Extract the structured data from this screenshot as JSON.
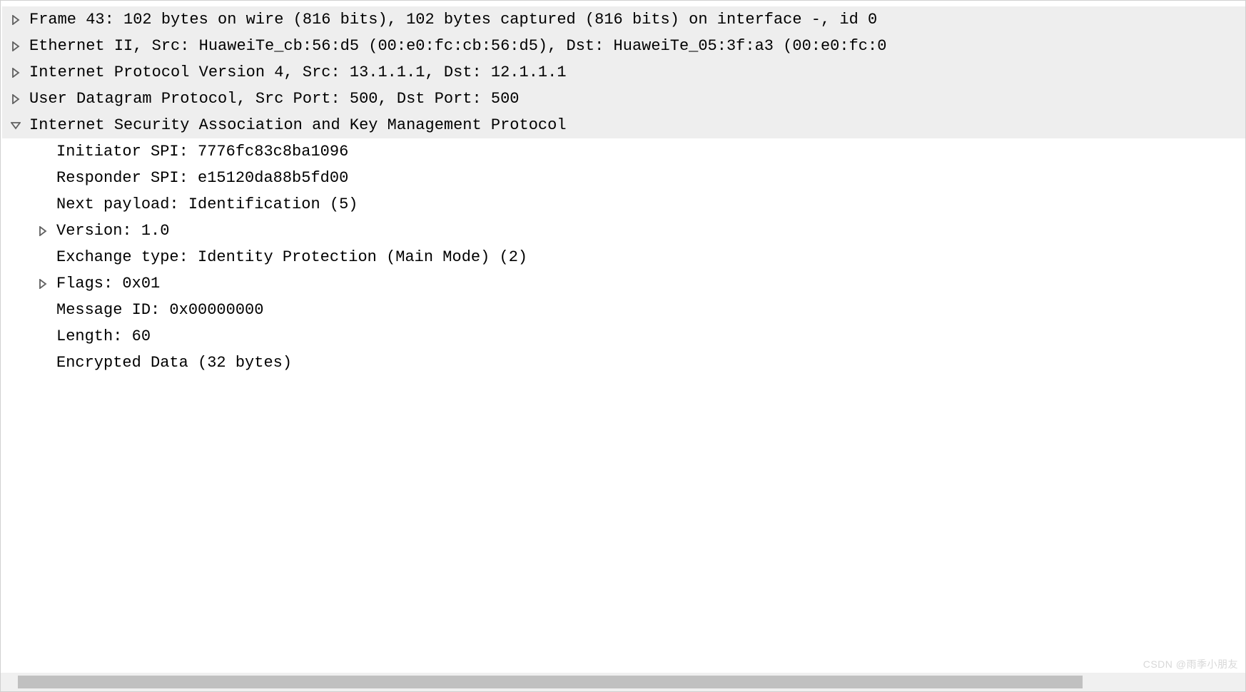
{
  "tree": {
    "rows": [
      {
        "icon": "right",
        "bg": "header",
        "indent": 0,
        "text": "Frame 43: 102 bytes on wire (816 bits), 102 bytes captured (816 bits) on interface -, id 0"
      },
      {
        "icon": "right",
        "bg": "header",
        "indent": 0,
        "text": "Ethernet II, Src: HuaweiTe_cb:56:d5 (00:e0:fc:cb:56:d5), Dst: HuaweiTe_05:3f:a3 (00:e0:fc:0"
      },
      {
        "icon": "right",
        "bg": "header",
        "indent": 0,
        "text": "Internet Protocol Version 4, Src: 13.1.1.1, Dst: 12.1.1.1"
      },
      {
        "icon": "right",
        "bg": "header",
        "indent": 0,
        "text": "User Datagram Protocol, Src Port: 500, Dst Port: 500"
      },
      {
        "icon": "down",
        "bg": "expanded",
        "indent": 0,
        "text": "Internet Security Association and Key Management Protocol"
      },
      {
        "icon": "none",
        "bg": "",
        "indent": 1,
        "text": "Initiator SPI: 7776fc83c8ba1096"
      },
      {
        "icon": "none",
        "bg": "",
        "indent": 1,
        "text": "Responder SPI: e15120da88b5fd00"
      },
      {
        "icon": "none",
        "bg": "",
        "indent": 1,
        "text": "Next payload: Identification (5)"
      },
      {
        "icon": "right",
        "bg": "",
        "indent": 1,
        "text": "Version: 1.0"
      },
      {
        "icon": "none",
        "bg": "",
        "indent": 1,
        "text": "Exchange type: Identity Protection (Main Mode) (2)"
      },
      {
        "icon": "right",
        "bg": "",
        "indent": 1,
        "text": "Flags: 0x01"
      },
      {
        "icon": "none",
        "bg": "",
        "indent": 1,
        "text": "Message ID: 0x00000000"
      },
      {
        "icon": "none",
        "bg": "",
        "indent": 1,
        "text": "Length: 60"
      },
      {
        "icon": "none",
        "bg": "",
        "indent": 1,
        "text": "Encrypted Data (32 bytes)"
      }
    ]
  },
  "watermark": "CSDN @雨季小朋友"
}
